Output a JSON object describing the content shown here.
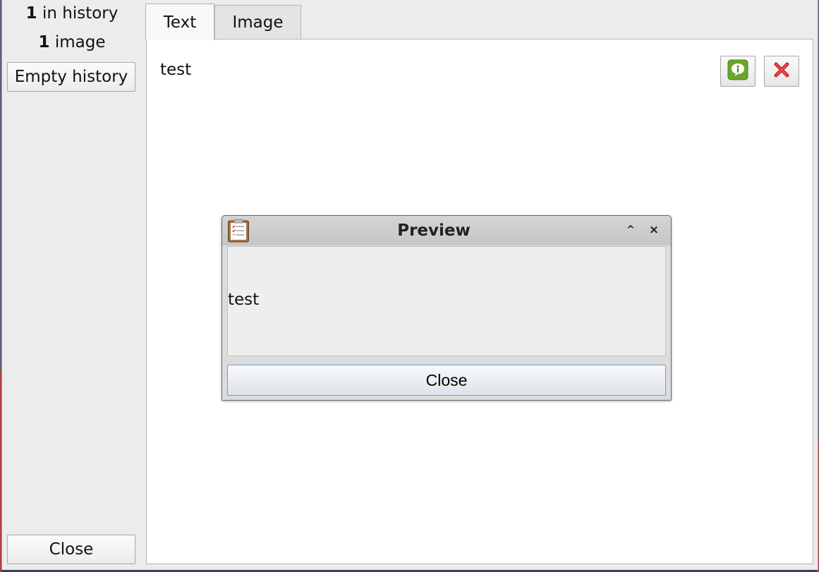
{
  "sidebar": {
    "history_count": "1",
    "history_label": " in history",
    "image_count": "1",
    "image_label": " image",
    "empty_history_label": "Empty history",
    "close_label": "Close"
  },
  "tabs": [
    {
      "label": "Text",
      "active": true
    },
    {
      "label": "Image",
      "active": false
    }
  ],
  "entries": [
    {
      "text": "test",
      "info_icon": "info-speech-icon",
      "delete_icon": "red-x-icon"
    }
  ],
  "preview_dialog": {
    "title": "Preview",
    "app_icon": "clipboard-icon",
    "content": "test",
    "close_label": "Close",
    "buttons": {
      "minimize": "^",
      "close": "×"
    }
  },
  "colors": {
    "info_green": "#6aa52a",
    "delete_red": "#d42020",
    "dialog_border_blue": "#6f9fd0"
  }
}
